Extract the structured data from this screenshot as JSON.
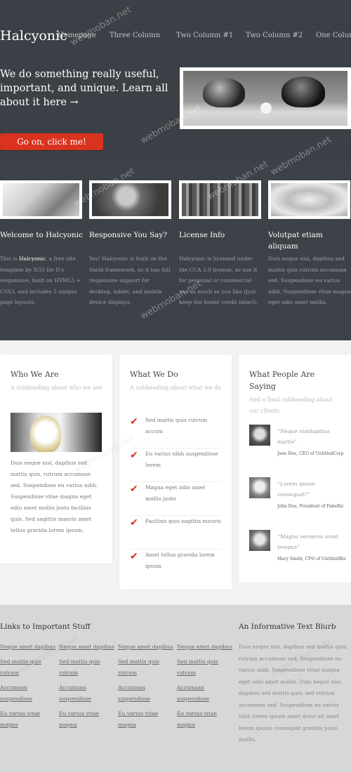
{
  "header": {
    "logo": "Halcyonic",
    "nav": [
      "Homepage",
      "Three Column",
      "Two Column #1",
      "Two Column #2",
      "One Column"
    ],
    "hero_text": "We do something really useful, important, and unique. Learn all about it here →",
    "cta_label": "Go on, click me!"
  },
  "features": [
    {
      "title": "Welcome to Halcyonic",
      "lead": "This is ",
      "lead_bold": "Halcyonic",
      "body": ", a free site template by N33 for It's responsive, built on HTML5 + CSS3, and includes 5 unique page layouts."
    },
    {
      "title": "Responsive You Say?",
      "lead": "",
      "lead_bold": "",
      "body": "Yes! Halcyonic is built on the Sarid framework, so it has full responsive support for desktop, tablet, and mobile device displays."
    },
    {
      "title": "License Info",
      "lead": "",
      "lead_bold": "",
      "body": "Halcyonic is licensed under the CCA 3.0 license, so use it for personal or commercial use as much as you like (just keep the footer credit intact)."
    },
    {
      "title": "Volutpat etiam aliquam",
      "lead": "",
      "lead_bold": "",
      "body": "Duis neque nisi, dapibus sed mattis quis rutrum accumsan sed. Suspendisse eu varius nibh. Suspendisse vitae magna eget odio amet mollis."
    }
  ],
  "who": {
    "title": "Who We Are",
    "subtitle": "A subheading about who we are",
    "body": "Duis neque nisi, dapibus sed mattis quis, rutrum accumsan sed. Suspendisse eu varius nibh. Suspendisse vitae magna eget odio amet mollis justo facilisis quis. Sed sagittis mauris amet tellus gravida lorem ipsum."
  },
  "what": {
    "title": "What We Do",
    "subtitle": "A subheading about what we do",
    "items": [
      "Sed mattis quis rutrum accum",
      "Eu varius nibh suspendisse lorem",
      "Magna eget odio amet mollis justo",
      "Facilisis quis sagittis mauris",
      "Amet tellus gravida lorem ipsum"
    ]
  },
  "people": {
    "title": "What People Are Saying",
    "subtitle": "And a final subheading about our clients",
    "quotes": [
      {
        "quote": "“Neque nisidapibus mattis”",
        "who": "Jane Doe, CEO of UntitledCorp"
      },
      {
        "quote": "“Lorem ipsum consequat!”",
        "who": "John Doe, President of FakeBiz"
      },
      {
        "quote": "“Magna veroeros amet tempus”",
        "who": "Mary Smith, CFO of UntitledBiz"
      }
    ]
  },
  "footer": {
    "links_title": "Links to Important Stuff",
    "links": [
      "Neque amet dapibus",
      "Sed mattis quis rutrum",
      "Accumsan suspendisse",
      "Eu varius vitae magna"
    ],
    "blurb_title": "An Informative Text Blurb",
    "blurb": "Duis neque nisi, dapibus sed mattis quis, rutrum accumsan sed. Suspendisse eu varius nibh. Suspendisse vitae magna eget odio amet mollis. Duis neque nisi, dapibus sed mattis quis, sed rutrum accumsan sed. Suspendisse eu varius nibh lorem ipsum amet dolor sit amet lorem ipsum consequat gravida justo mollis."
  },
  "watermark": "webmoban.net",
  "colors": {
    "accent": "#d9321f",
    "header_bg": "#3a3f45",
    "footer_bg": "#d5d7d9"
  }
}
